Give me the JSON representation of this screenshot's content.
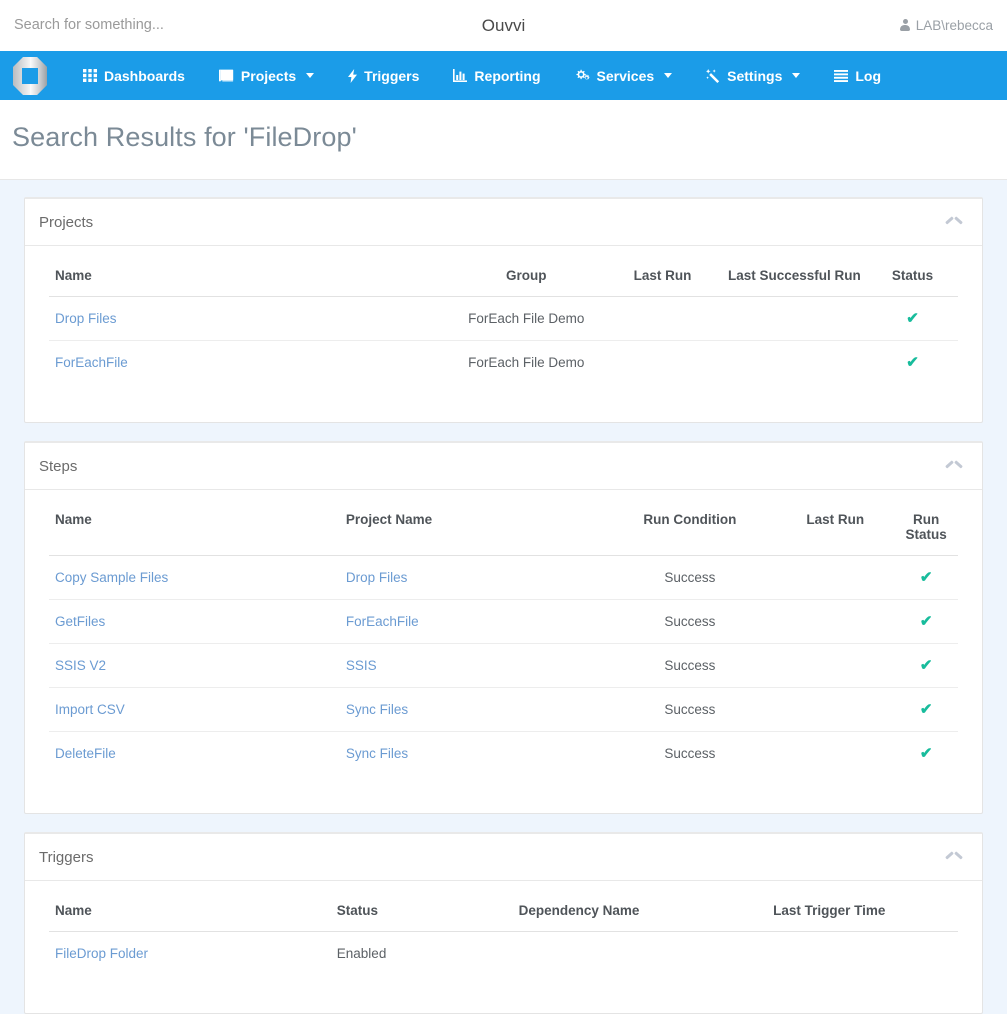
{
  "topbar": {
    "search_placeholder": "Search for something...",
    "search_value": "",
    "app_title": "Ouvvi",
    "user_label": "LAB\\rebecca",
    "user_icon": "user-icon"
  },
  "nav": {
    "logo_icon": "ouvvi-logo-icon",
    "items": [
      {
        "label": "Dashboards",
        "icon": "grid-icon",
        "caret": false
      },
      {
        "label": "Projects",
        "icon": "book-icon",
        "caret": true
      },
      {
        "label": "Triggers",
        "icon": "bolt-icon",
        "caret": false
      },
      {
        "label": "Reporting",
        "icon": "bar-chart-icon",
        "caret": false
      },
      {
        "label": "Services",
        "icon": "cogs-icon",
        "caret": true
      },
      {
        "label": "Settings",
        "icon": "magic-wand-icon",
        "caret": true
      },
      {
        "label": "Log",
        "icon": "list-icon",
        "caret": false
      }
    ]
  },
  "page": {
    "title": "Search Results for 'FileDrop'"
  },
  "panels": {
    "projects": {
      "title": "Projects",
      "collapse_icon": "chevron-up-icon",
      "columns": [
        "Name",
        "Group",
        "Last Run",
        "Last Successful Run",
        "Status"
      ],
      "rows": [
        {
          "name": "Drop Files",
          "group": "ForEach File Demo",
          "last_run": "",
          "last_successful_run": "",
          "status": "✔"
        },
        {
          "name": "ForEachFile",
          "group": "ForEach File Demo",
          "last_run": "",
          "last_successful_run": "",
          "status": "✔"
        }
      ]
    },
    "steps": {
      "title": "Steps",
      "collapse_icon": "chevron-up-icon",
      "columns": [
        "Name",
        "Project Name",
        "Run Condition",
        "Last Run",
        "Run Status"
      ],
      "rows": [
        {
          "name": "Copy Sample Files",
          "project_name": "Drop Files",
          "run_condition": "Success",
          "last_run": "",
          "run_status": "✔"
        },
        {
          "name": "GetFiles",
          "project_name": "ForEachFile",
          "run_condition": "Success",
          "last_run": "",
          "run_status": "✔"
        },
        {
          "name": "SSIS V2",
          "project_name": "SSIS",
          "run_condition": "Success",
          "last_run": "",
          "run_status": "✔"
        },
        {
          "name": "Import CSV",
          "project_name": "Sync Files",
          "run_condition": "Success",
          "last_run": "",
          "run_status": "✔"
        },
        {
          "name": "DeleteFile",
          "project_name": "Sync Files",
          "run_condition": "Success",
          "last_run": "",
          "run_status": "✔"
        }
      ]
    },
    "triggers": {
      "title": "Triggers",
      "collapse_icon": "chevron-up-icon",
      "columns": [
        "Name",
        "Status",
        "Dependency Name",
        "Last Trigger Time"
      ],
      "rows": [
        {
          "name": "FileDrop Folder",
          "status": "Enabled",
          "dependency_name": "",
          "last_trigger_time": ""
        }
      ]
    }
  },
  "colors": {
    "navbar_blue": "#1b9ce8",
    "page_background": "#eef5fd",
    "link_blue": "#6b9bd2",
    "status_green": "#18bc9c",
    "title_gray": "#7b8a96"
  }
}
